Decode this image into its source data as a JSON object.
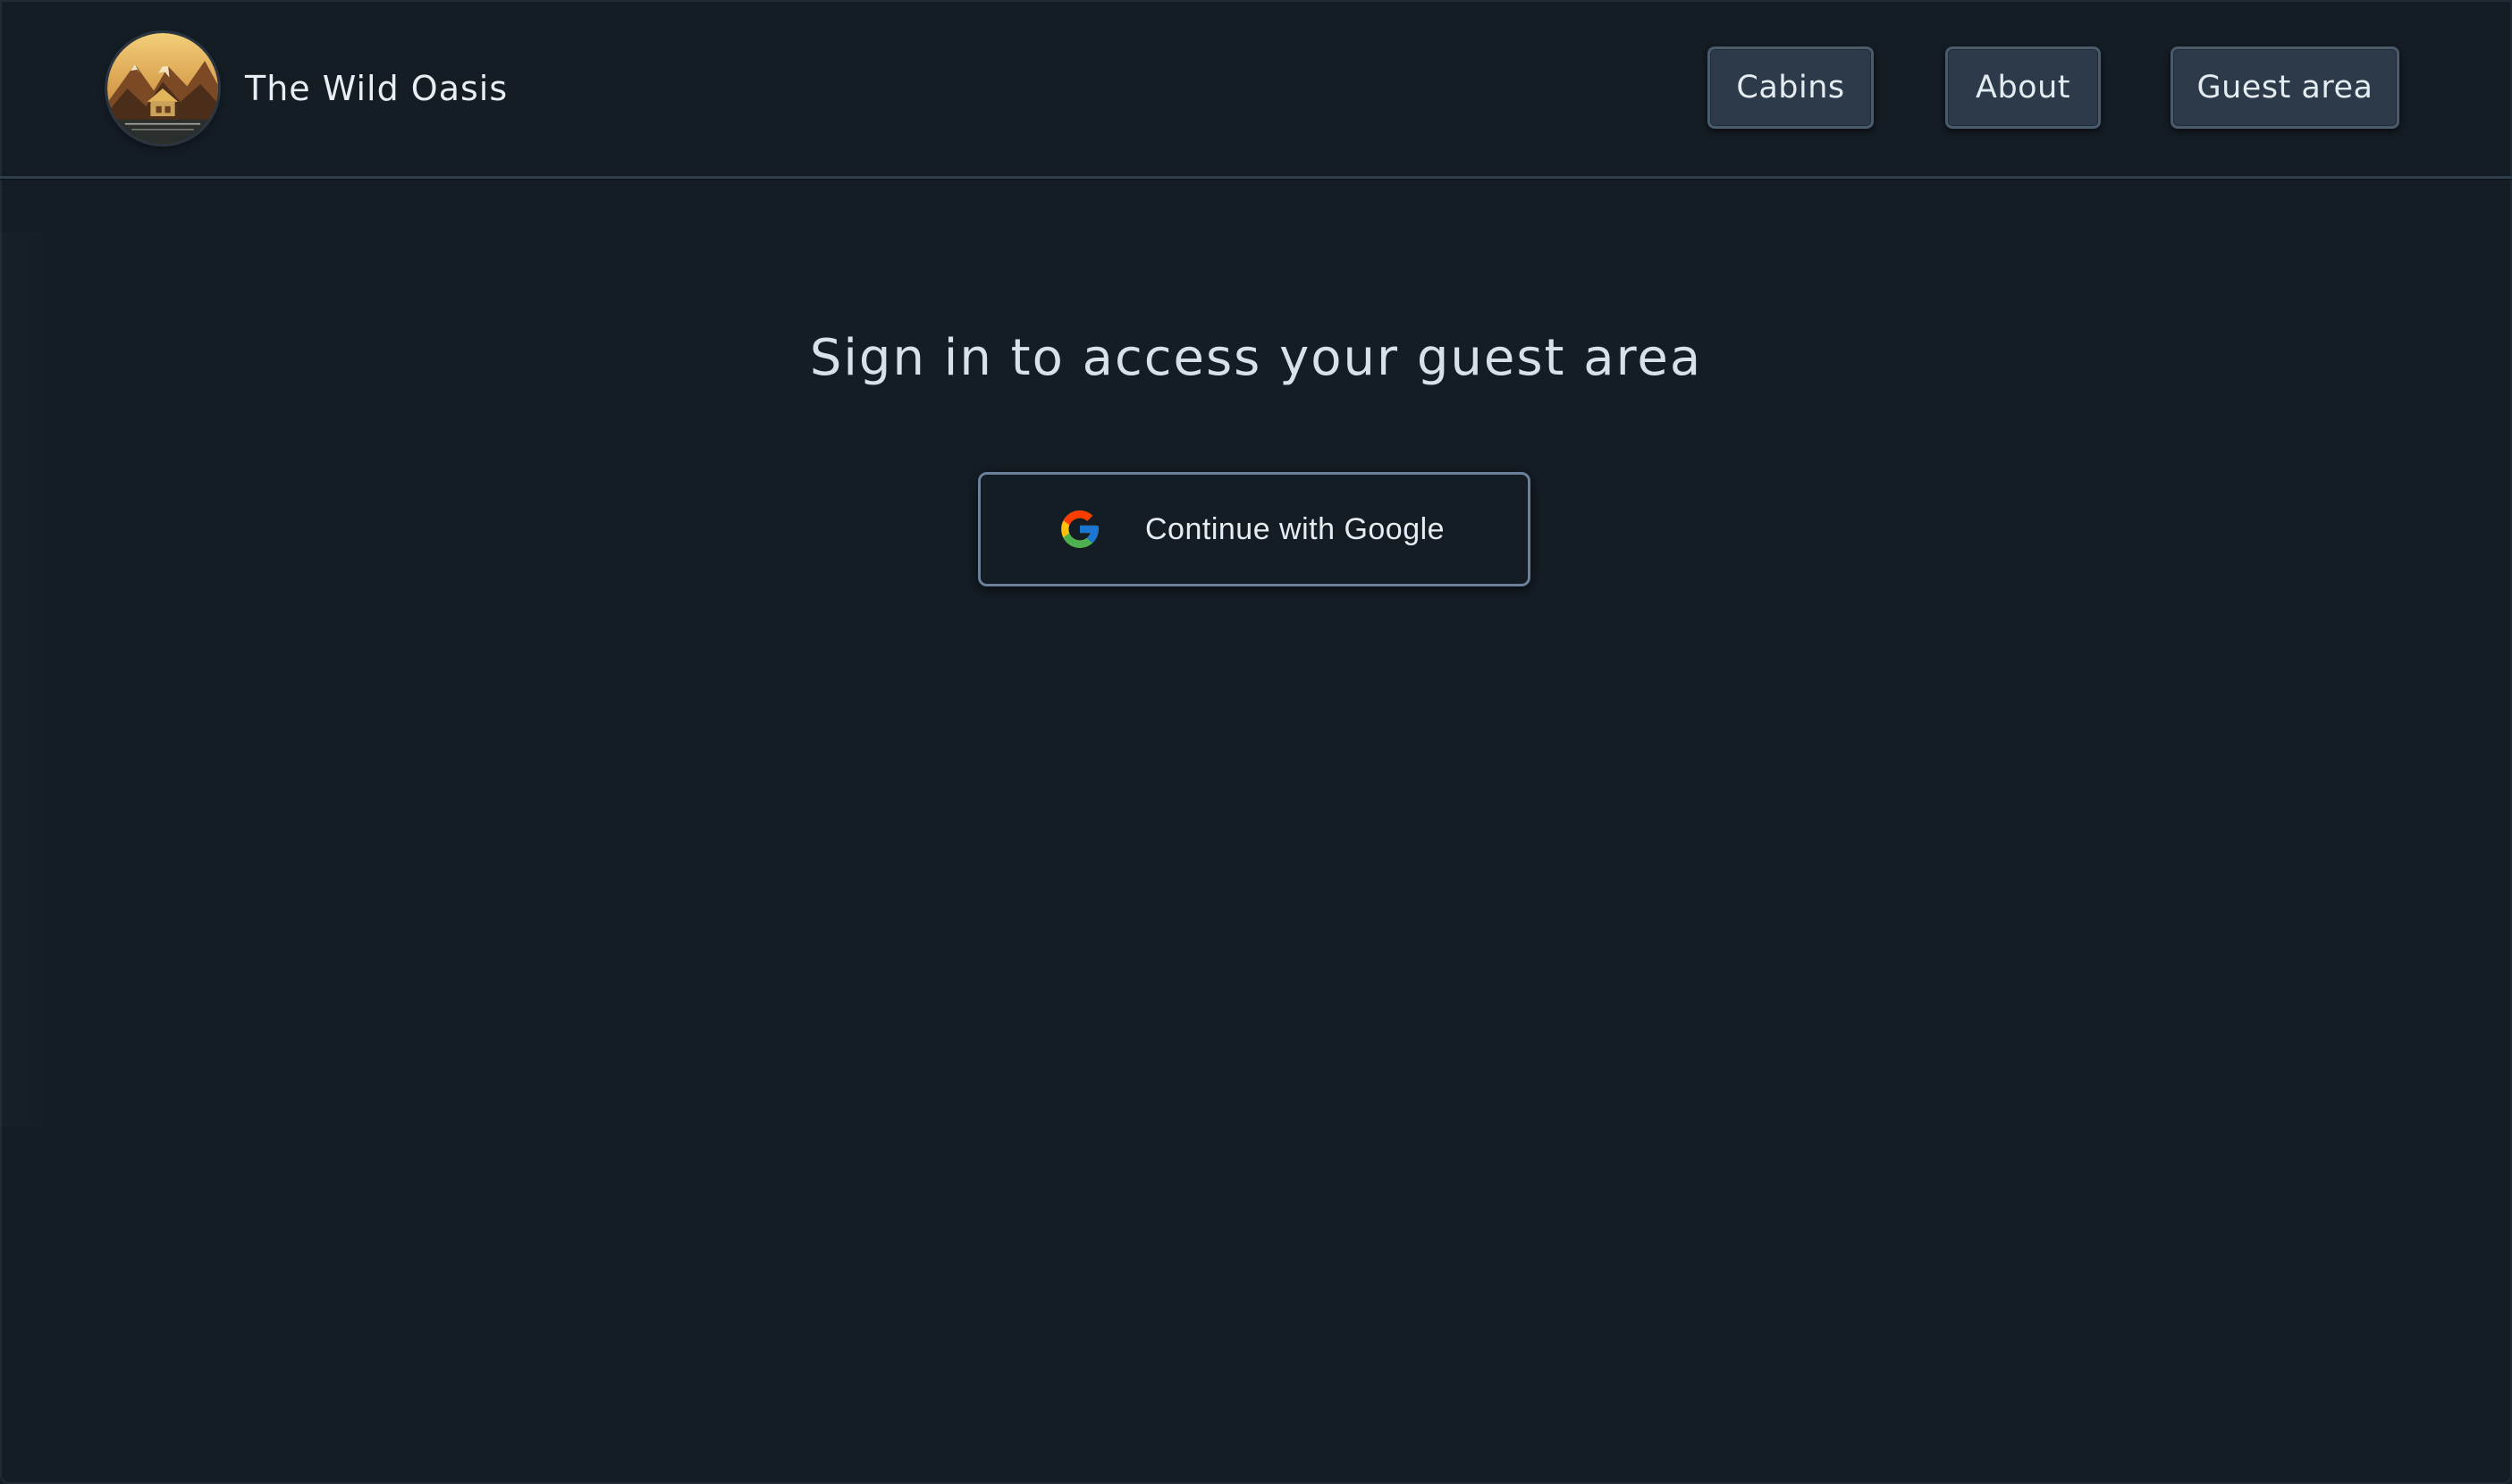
{
  "header": {
    "logo_text": "The Wild Oasis",
    "nav": [
      {
        "label": "Cabins"
      },
      {
        "label": "About"
      },
      {
        "label": "Guest area"
      }
    ]
  },
  "main": {
    "heading": "Sign in to access your guest area",
    "google_button_label": "Continue with Google"
  },
  "colors": {
    "background": "#141c24",
    "nav_button_bg": "#2c3a49",
    "text": "#d4dee7"
  },
  "icons": {
    "logo": "mountain-cabin-logo",
    "google": "google-g-icon"
  }
}
